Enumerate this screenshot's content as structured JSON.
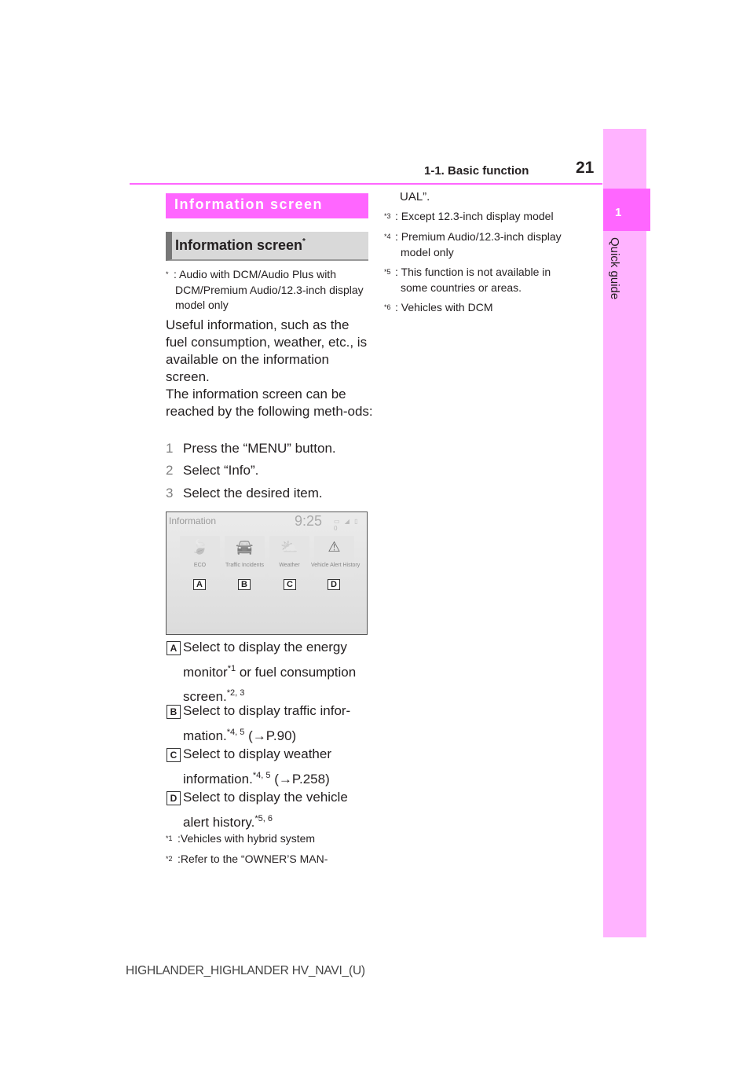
{
  "header": {
    "section": "1-1. Basic function",
    "page_number": "21"
  },
  "side_tab": {
    "chapter_number": "1",
    "chapter_label": "Quick guide"
  },
  "section_title": "Information screen",
  "subsection": {
    "title": "Information screen",
    "marker": "*"
  },
  "subsection_note": {
    "marker": "*",
    "text": ": Audio with DCM/Audio Plus with DCM/Premium Audio/12.3-inch display model only"
  },
  "intro": [
    "Useful information, such as the fuel consumption, weather, etc., is available on the information screen.",
    "The information screen can be reached by the following meth-ods:"
  ],
  "steps": [
    {
      "num": "1",
      "text": "Press the “MENU” button."
    },
    {
      "num": "2",
      "text": "Select “Info”."
    },
    {
      "num": "3",
      "text": "Select the desired item."
    }
  ],
  "screen": {
    "title": "Information",
    "time": "9:25",
    "status": "▭ ◢ ▯ 0",
    "tiles": [
      {
        "label": "ECO",
        "icon": "leaf-icon",
        "glyph": "🍃",
        "tag": "A"
      },
      {
        "label": "Traffic Incidents",
        "icon": "traffic-car-icon",
        "glyph": "🚘",
        "tag": "B"
      },
      {
        "label": "Weather",
        "icon": "sun-cloud-icon",
        "glyph": "⛅",
        "tag": "C"
      },
      {
        "label": "Vehicle Alert History",
        "icon": "alert-list-icon",
        "glyph": "⚠",
        "tag": "D"
      }
    ]
  },
  "items": [
    {
      "tag": "A",
      "l1": "Select to display the energy",
      "l2a": "monitor",
      "s1": "*1",
      "l2b": " or fuel consumption",
      "l3": "screen.",
      "s2": "*2, 3"
    },
    {
      "tag": "B",
      "l1": "Select to display traffic infor-",
      "l2a": "mation.",
      "s1": "*4, 5",
      "l2b": " (→P.90)"
    },
    {
      "tag": "C",
      "l1": "Select to display weather",
      "l2a": "information.",
      "s1": "*4, 5",
      "l2b": " (→P.258)"
    },
    {
      "tag": "D",
      "l1": "Select to display the vehicle",
      "l2a": "alert history.",
      "s1": "*5, 6",
      "l2b": ""
    }
  ],
  "footnotes": [
    {
      "mark": "*1",
      "text": ":Vehicles with hybrid system"
    },
    {
      "mark": "*2",
      "text": ":Refer to the “OWNER’S MAN-",
      "cont": "UAL”."
    },
    {
      "mark": "*3",
      "text": ": Except 12.3-inch display model"
    },
    {
      "mark": "*4",
      "text": ": Premium Audio/12.3-inch display",
      "cont": "model only"
    },
    {
      "mark": "*5",
      "text": ": This function is not available in",
      "cont": "some countries or areas."
    },
    {
      "mark": "*6",
      "text": ": Vehicles with DCM"
    }
  ],
  "footer": "HIGHLANDER_HIGHLANDER HV_NAVI_(U)"
}
